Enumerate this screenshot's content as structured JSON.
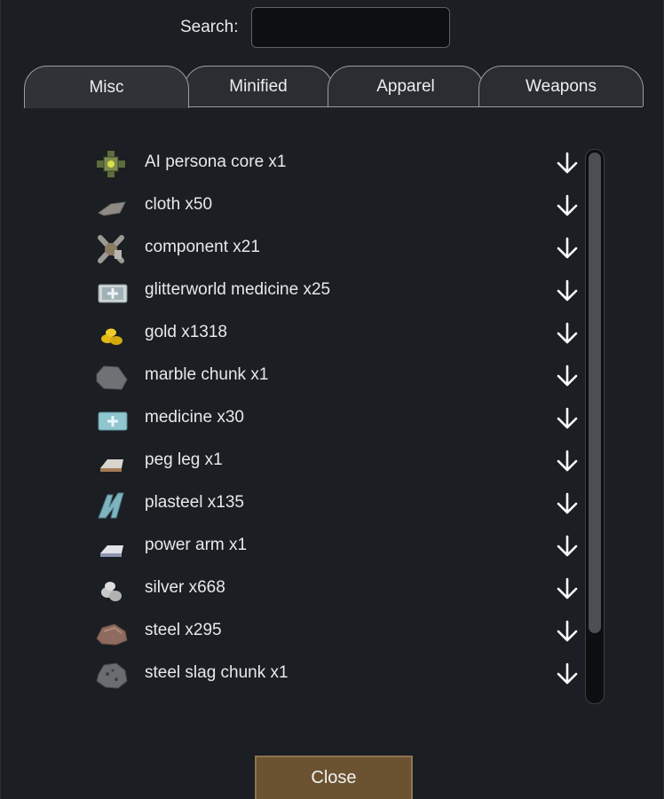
{
  "search": {
    "label": "Search:",
    "value": "",
    "placeholder": ""
  },
  "tabs": [
    {
      "label": "Misc",
      "active": true
    },
    {
      "label": "Minified",
      "active": false
    },
    {
      "label": "Apparel",
      "active": false
    },
    {
      "label": "Weapons",
      "active": false
    }
  ],
  "items": [
    {
      "label": "AI persona core x1",
      "icon": "ai-persona-core-icon"
    },
    {
      "label": "cloth x50",
      "icon": "cloth-icon"
    },
    {
      "label": "component x21",
      "icon": "component-icon"
    },
    {
      "label": "glitterworld medicine x25",
      "icon": "glitterworld-medicine-icon"
    },
    {
      "label": "gold x1318",
      "icon": "gold-icon"
    },
    {
      "label": "marble chunk x1",
      "icon": "marble-chunk-icon"
    },
    {
      "label": "medicine x30",
      "icon": "medicine-icon"
    },
    {
      "label": "peg leg x1",
      "icon": "peg-leg-icon"
    },
    {
      "label": "plasteel x135",
      "icon": "plasteel-icon"
    },
    {
      "label": "power arm x1",
      "icon": "power-arm-icon"
    },
    {
      "label": "silver x668",
      "icon": "silver-icon"
    },
    {
      "label": "steel x295",
      "icon": "steel-icon"
    },
    {
      "label": "steel slag chunk x1",
      "icon": "steel-slag-chunk-icon"
    }
  ],
  "close_label": "Close",
  "colors": {
    "background": "#1b1e22",
    "tab": "#2a2d31",
    "close_button": "#6b5331"
  }
}
